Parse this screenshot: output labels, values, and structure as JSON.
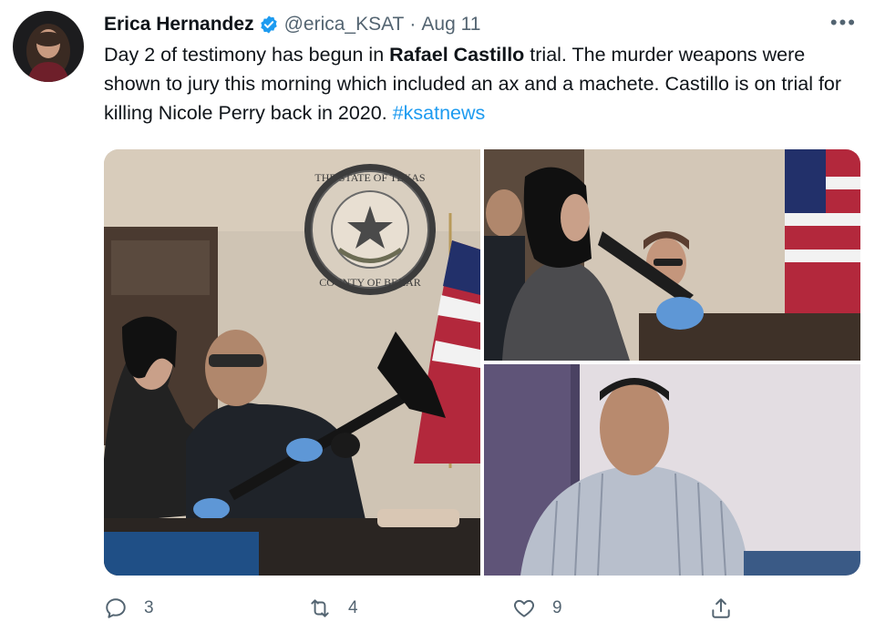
{
  "author": {
    "name": "Erica Hernandez",
    "handle": "@erica_KSAT",
    "separator": "·",
    "date": "Aug 11",
    "verified_icon": "verified-badge-icon"
  },
  "tweet": {
    "text_part1": "Day 2 of testimony has begun in ",
    "text_bold": "Rafael Castillo",
    "text_part2": " trial. The murder weapons were shown to jury this morning which included an ax and a machete. Castillo is on trial for killing Nicole Perry back in 2020. ",
    "hashtag": "#ksatnews"
  },
  "media": {
    "seal_text_top": "THE STATE OF TEXAS",
    "seal_text_bottom": "COUNTY OF BEXAR"
  },
  "actions": {
    "reply_count": "3",
    "retweet_count": "4",
    "like_count": "9"
  },
  "colors": {
    "link": "#1d9bf0",
    "verified": "#1d9bf0",
    "muted": "#536471"
  }
}
